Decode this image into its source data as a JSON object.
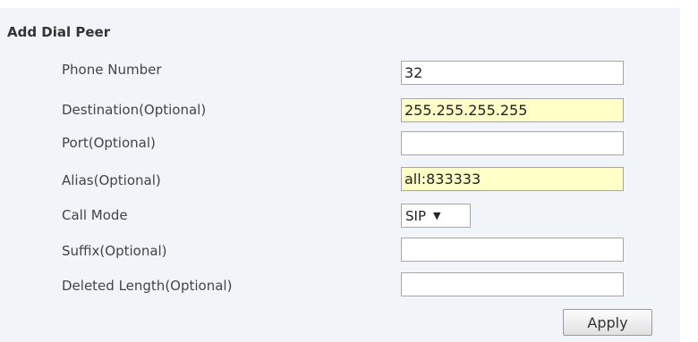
{
  "form": {
    "title": "Add Dial Peer",
    "fields": [
      {
        "label": "Phone Number",
        "value": "32"
      },
      {
        "label": "Destination(Optional)",
        "value": "255.255.255.255"
      },
      {
        "label": "Port(Optional)",
        "value": ""
      },
      {
        "label": "Alias(Optional)",
        "value": "all:833333"
      },
      {
        "label": "Call Mode",
        "value": "SIP"
      },
      {
        "label": "Suffix(Optional)",
        "value": ""
      },
      {
        "label": "Deleted Length(Optional)",
        "value": ""
      }
    ],
    "apply_label": "Apply"
  },
  "colors": {
    "panel_background": "#f1f4f8",
    "autofill_highlight": "#ffffc8"
  },
  "icons": {
    "call_mode_dropdown": "caret-down-icon"
  }
}
